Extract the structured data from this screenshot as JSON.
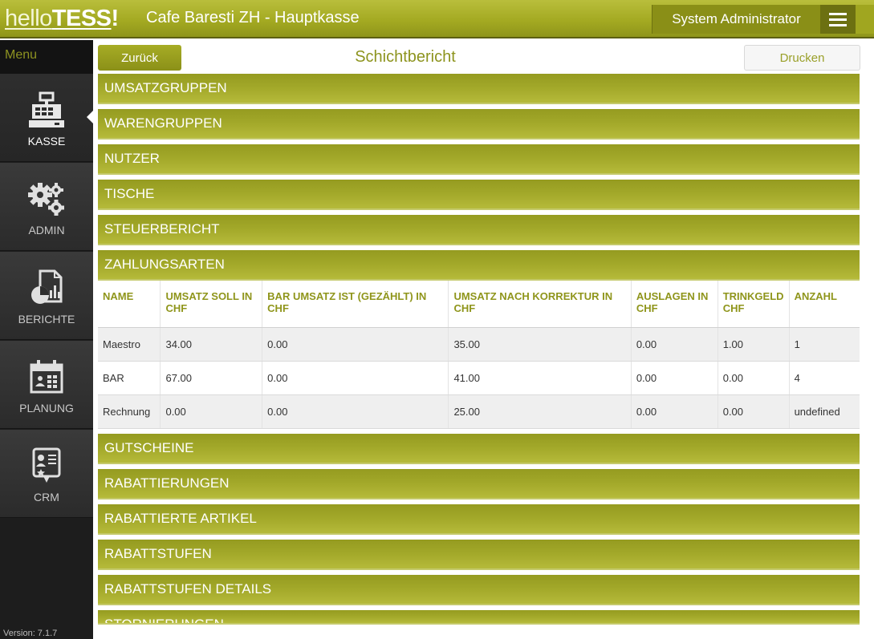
{
  "topbar": {
    "logo_hello": "hello",
    "logo_tess": "TESS",
    "logo_bang": "!",
    "title": "Cafe Baresti ZH - Hauptkasse",
    "user": "System Administrator"
  },
  "sidebar": {
    "menu_label": "Menu",
    "items": [
      {
        "label": "KASSE",
        "icon": "cash-register-icon"
      },
      {
        "label": "ADMIN",
        "icon": "gears-icon"
      },
      {
        "label": "BERICHTE",
        "icon": "report-icon"
      },
      {
        "label": "PLANUNG",
        "icon": "calendar-icon"
      },
      {
        "label": "CRM",
        "icon": "contact-card-icon"
      }
    ],
    "version": "Version: 7.1.7"
  },
  "header": {
    "back_label": "Zurück",
    "title": "Schichtbericht",
    "print_label": "Drucken"
  },
  "sections_before": [
    "UMSATZGRUPPEN",
    "WARENGRUPPEN",
    "NUTZER",
    "TISCHE",
    "STEUERBERICHT",
    "ZAHLUNGSARTEN"
  ],
  "payment_table": {
    "columns": [
      "NAME",
      "UMSATZ SOLL IN CHF",
      "BAR UMSATZ IST (GEZÄHLT) IN CHF",
      "UMSATZ NACH KORREKTUR IN CHF",
      "AUSLAGEN IN CHF",
      "TRINKGELD CHF",
      "ANZAHL"
    ],
    "rows": [
      [
        "Maestro",
        "34.00",
        "0.00",
        "35.00",
        "0.00",
        "1.00",
        "1"
      ],
      [
        "BAR",
        "67.00",
        "0.00",
        "41.00",
        "0.00",
        "0.00",
        "4"
      ],
      [
        "Rechnung",
        "0.00",
        "0.00",
        "25.00",
        "0.00",
        "0.00",
        "undefined"
      ]
    ]
  },
  "sections_after": [
    "GUTSCHEINE",
    "RABATTIERUNGEN",
    "RABATTIERTE ARTIKEL",
    "RABATTSTUFEN",
    "RABATTSTUFEN DETAILS",
    "STORNIERUNGEN"
  ],
  "colors": {
    "accent": "#a4aa22",
    "sidebar": "#1d1d1d"
  }
}
